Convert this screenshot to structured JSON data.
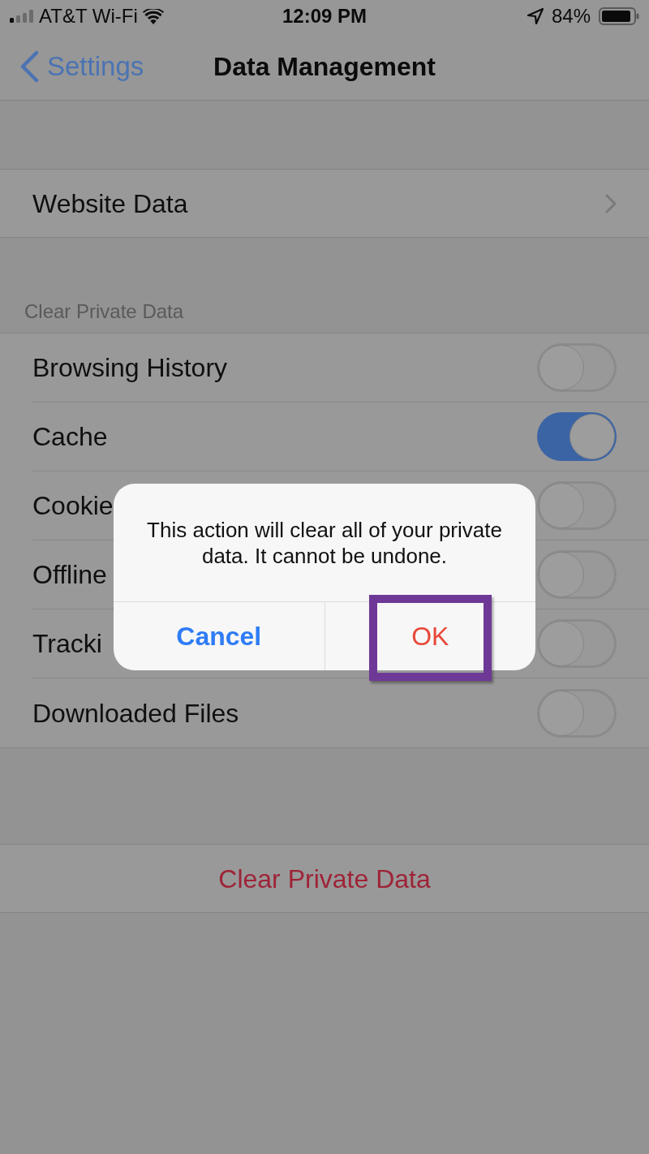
{
  "status_bar": {
    "carrier": "AT&T Wi-Fi",
    "time": "12:09 PM",
    "battery": "84%"
  },
  "nav_bar": {
    "back": "Settings",
    "title": "Data Management"
  },
  "website_data": {
    "label": "Website Data"
  },
  "clear_section": {
    "header": "Clear Private Data",
    "items": [
      {
        "label": "Browsing History",
        "on": false
      },
      {
        "label": "Cache",
        "on": true
      },
      {
        "label": "Cookie",
        "on": false
      },
      {
        "label": "Offline",
        "on": false
      },
      {
        "label": "Tracki",
        "on": false
      },
      {
        "label": "Downloaded Files",
        "on": false
      }
    ]
  },
  "clear_button": {
    "label": "Clear Private Data"
  },
  "alert": {
    "message": "This action will clear all of your private data. It cannot be undone.",
    "buttons": [
      {
        "label": "Cancel",
        "kind": "cancel",
        "highlighted": false
      },
      {
        "label": "OK",
        "kind": "destructive",
        "highlighted": true
      }
    ]
  }
}
